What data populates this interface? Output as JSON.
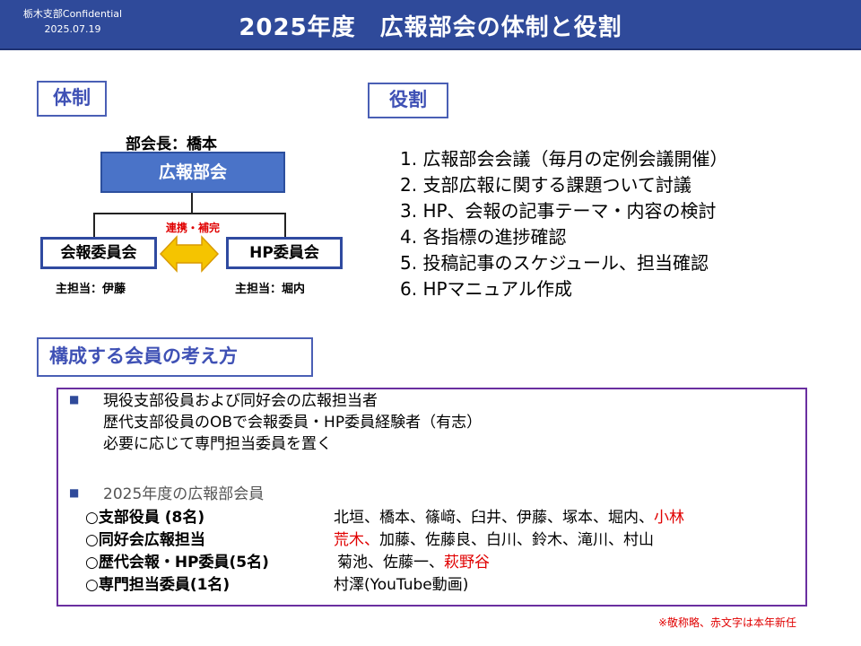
{
  "header": {
    "org": "栃木支部Confidential",
    "date": "2025.07.19",
    "title": "2025年度　広報部会の体制と役割"
  },
  "sections": {
    "taisei": "体制",
    "yakuwari": "役割",
    "kosei": "構成する会員の考え方"
  },
  "org_chart": {
    "head_label": "部会長：橋本",
    "main": "広報部会",
    "link_label": "連携・補完",
    "children": [
      {
        "name": "会報委員会",
        "lead": "主担当：伊藤"
      },
      {
        "name": "HP委員会",
        "lead": "主担当：堀内"
      }
    ]
  },
  "roles": [
    "1. 広報部会会議（毎月の定例会議開催）",
    "2. 支部広報に関する課題ついて討議",
    "3. HP、会報の記事テーマ・内容の検討",
    "4. 各指標の進捗確認",
    "5. 投稿記事のスケジュール、担当確認",
    "6. HPマニュアル作成"
  ],
  "members": {
    "bullet1": "現役支部役員および同好会の広報担当者",
    "line2": "歴代支部役員のOBで会報委員・HP委員経験者（有志）",
    "line3": "必要に応じて専門担当委員を置く",
    "bullet2": "2025年度の広報部会員",
    "categories": [
      {
        "label": "○支部役員 (8名)",
        "names": "北垣、橋本、篠﨑、臼井、伊藤、塚本、堀内、",
        "new_names": "小林",
        "names_after": ""
      },
      {
        "label": "○同好会広報担当",
        "names": "",
        "new_names": "荒木、",
        "names_after": "加藤、佐藤良、白川、鈴木、滝川、村山"
      },
      {
        "label": "○歴代会報・HP委員(5名)",
        "names": "菊池、佐藤一、",
        "new_names": "萩野谷",
        "names_after": ""
      },
      {
        "label": "○専門担当委員(1名)",
        "names": "村澤(YouTube動画)",
        "new_names": "",
        "names_after": ""
      }
    ]
  },
  "footnote": "※敬称略、赤文字は本年新任",
  "colors": {
    "header_bg": "#2f4a9a",
    "section_border": "#4a5fb5",
    "main_box": "#4a73c8",
    "arrow_fill": "#f5c400",
    "new_member_red": "#e00000",
    "members_border": "#6a2fa0"
  },
  "icons": {
    "bullet": "square-bullet-icon",
    "arrow": "double-arrow-icon"
  }
}
